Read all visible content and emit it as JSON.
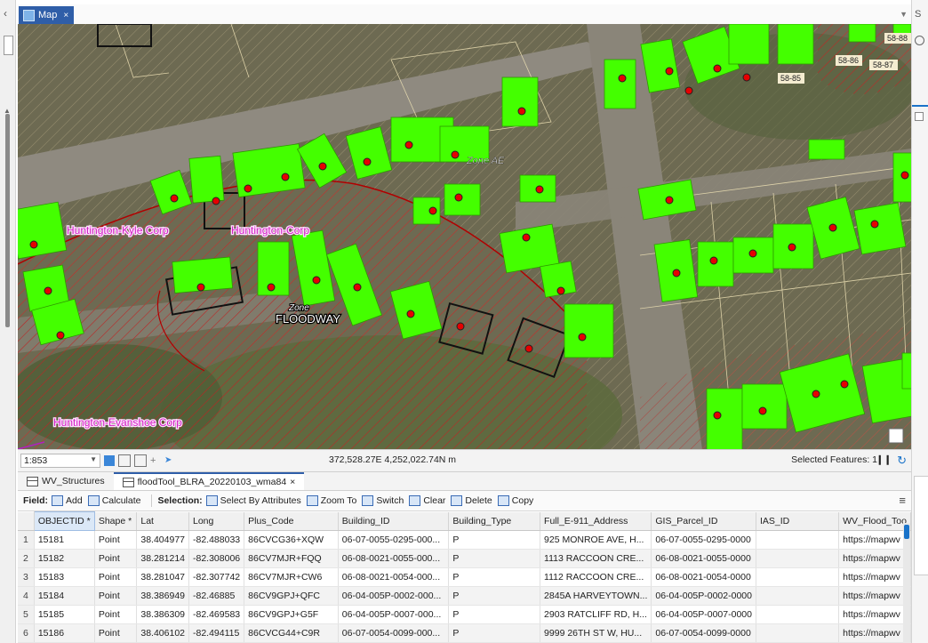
{
  "map_tab": {
    "label": "Map",
    "close": "×"
  },
  "map": {
    "labels": {
      "zone_ae": "Zone AE",
      "floodway": "FLOODWAY",
      "zone_small": "Zone",
      "corp1": "Huntington-Kyle Corp",
      "corp2": "Huntington-Corp",
      "corp3": "Huntington-Evanshoe Corp",
      "parcel_a": "58-86",
      "parcel_b": "58-87",
      "parcel_c": "58-85",
      "parcel_d": "58-88"
    }
  },
  "statusbar": {
    "scale": "1:853",
    "coords": "372,528.27E 4,252,022.74N m",
    "selected_features": "Selected Features: 1"
  },
  "table_tabs": [
    {
      "label": "WV_Structures"
    },
    {
      "label": "floodTool_BLRA_20220103_wma84",
      "close": "×"
    }
  ],
  "toolbar": {
    "field_label": "Field:",
    "add": "Add",
    "calculate": "Calculate",
    "selection_label": "Selection:",
    "select_by_attributes": "Select By Attributes",
    "zoom_to": "Zoom To",
    "switch": "Switch",
    "clear": "Clear",
    "delete": "Delete",
    "copy": "Copy"
  },
  "table": {
    "columns": [
      "OBJECTID *",
      "Shape *",
      "Lat",
      "Long",
      "Plus_Code",
      "Building_ID",
      "Building_Type",
      "Full_E-911_Address",
      "GIS_Parcel_ID",
      "IAS_ID",
      "WV_Flood_Too"
    ],
    "rows": [
      [
        "1",
        "15181",
        "Point",
        "38.404977",
        "-82.488033",
        "86CVCG36+XQW",
        "06-07-0055-0295-000...",
        "P",
        "925 MONROE AVE, H...",
        "06-07-0055-0295-0000",
        "",
        "https://mapwv"
      ],
      [
        "2",
        "15182",
        "Point",
        "38.281214",
        "-82.308006",
        "86CV7MJR+FQQ",
        "06-08-0021-0055-000...",
        "P",
        "1113 RACCOON CRE...",
        "06-08-0021-0055-0000",
        "",
        "https://mapwv"
      ],
      [
        "3",
        "15183",
        "Point",
        "38.281047",
        "-82.307742",
        "86CV7MJR+CW6",
        "06-08-0021-0054-000...",
        "P",
        "1112 RACCOON CRE...",
        "06-08-0021-0054-0000",
        "",
        "https://mapwv"
      ],
      [
        "4",
        "15184",
        "Point",
        "38.386949",
        "-82.46885",
        "86CV9GPJ+QFC",
        "06-04-005P-0002-000...",
        "P",
        "2845A HARVEYTOWN...",
        "06-04-005P-0002-0000",
        "",
        "https://mapwv"
      ],
      [
        "5",
        "15185",
        "Point",
        "38.386309",
        "-82.469583",
        "86CV9GPJ+G5F",
        "06-04-005P-0007-000...",
        "P",
        "2903 RATCLIFF RD, H...",
        "06-04-005P-0007-0000",
        "",
        "https://mapwv"
      ],
      [
        "6",
        "15186",
        "Point",
        "38.406102",
        "-82.494115",
        "86CVCG44+C9R",
        "06-07-0054-0099-000...",
        "P",
        "9999 26TH ST W, HU...",
        "06-07-0054-0099-0000",
        "",
        "https://mapwv"
      ]
    ]
  }
}
